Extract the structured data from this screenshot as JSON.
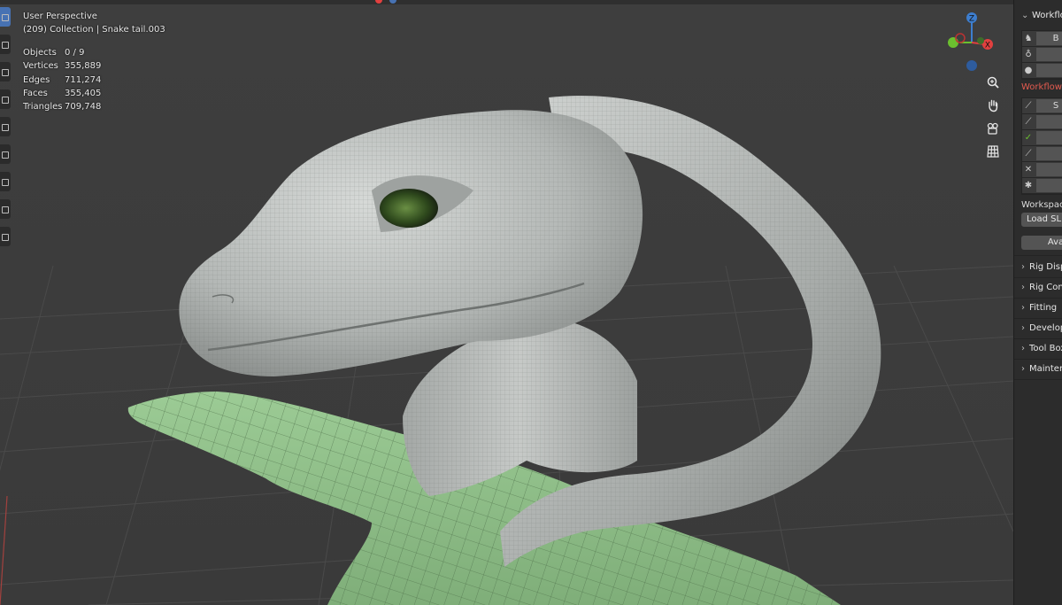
{
  "viewport": {
    "view_name": "User Perspective",
    "collection_info": "(209) Collection | Snake tail.003",
    "stats": [
      {
        "label": "Objects",
        "value": "0 / 9"
      },
      {
        "label": "Vertices",
        "value": "355,889"
      },
      {
        "label": "Edges",
        "value": "711,274"
      },
      {
        "label": "Faces",
        "value": "355,405"
      },
      {
        "label": "Triangles",
        "value": "709,748"
      }
    ]
  },
  "gizmo": {
    "z_label": "Z",
    "x_label": "X"
  },
  "npanel": {
    "workflow_title": "Workflow",
    "workflow_rows": [
      "B",
      "",
      ""
    ],
    "workflow_red_heading": "Workflow F",
    "tool_rows": [
      "S",
      "",
      "",
      "",
      "",
      ""
    ],
    "workspace_label": "Workspace",
    "load_button": "Load SL A",
    "ava_button": "Ava",
    "sections": [
      "Rig Disp",
      "Rig Cont",
      "Fitting",
      "Develop",
      "Tool Box",
      "Mainten"
    ]
  },
  "colors": {
    "axis_x": "#e2403f",
    "axis_y": "#6bbf2f",
    "axis_z": "#3d7ecf",
    "accent_red": "#e25a4f",
    "mesh_green": "#8fbf8a",
    "mesh_grey": "#b9bdbb"
  },
  "icons": [
    "select-tool-icon",
    "cursor-icon",
    "move-icon",
    "rotate-icon",
    "scale-icon",
    "transform-icon",
    "annotate-icon",
    "measure-icon",
    "add-cube-icon",
    "zoom-icon",
    "hand-pan-icon",
    "camera-icon",
    "grid-view-icon",
    "armature-icon",
    "bulb-icon",
    "sphere-icon"
  ]
}
